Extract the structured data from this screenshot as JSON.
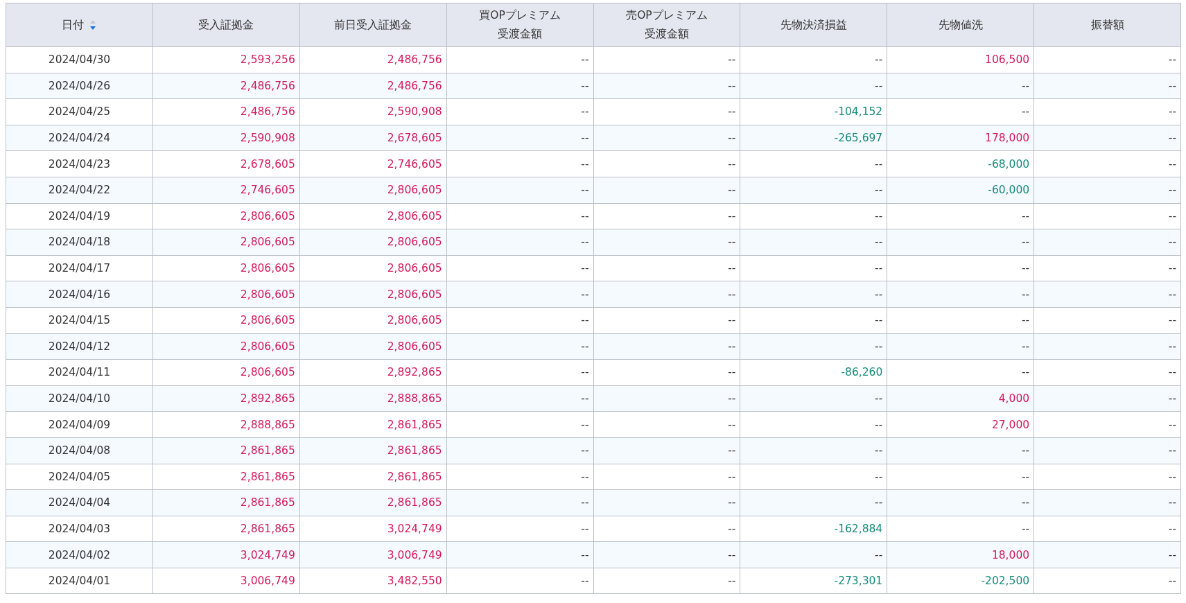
{
  "table": {
    "columns": [
      {
        "lines": [
          "日付"
        ],
        "sort_desc": true
      },
      {
        "lines": [
          "受入証拠金"
        ]
      },
      {
        "lines": [
          "前日受入証拠金"
        ]
      },
      {
        "lines": [
          "買OPプレミアム",
          "受渡金額"
        ]
      },
      {
        "lines": [
          "売OPプレミアム",
          "受渡金額"
        ]
      },
      {
        "lines": [
          "先物決済損益"
        ]
      },
      {
        "lines": [
          "先物値洗"
        ]
      },
      {
        "lines": [
          "振替額"
        ]
      }
    ],
    "rows": [
      {
        "cells": [
          {
            "v": "2024/04/30"
          },
          {
            "v": "2,593,256",
            "color": "#d2185a"
          },
          {
            "v": "2,486,756",
            "color": "#d2185a"
          },
          {
            "v": "--"
          },
          {
            "v": "--"
          },
          {
            "v": "--"
          },
          {
            "v": "106,500",
            "color": "#d2185a"
          },
          {
            "v": "--"
          }
        ]
      },
      {
        "cells": [
          {
            "v": "2024/04/26"
          },
          {
            "v": "2,486,756",
            "color": "#d2185a"
          },
          {
            "v": "2,486,756",
            "color": "#d2185a"
          },
          {
            "v": "--"
          },
          {
            "v": "--"
          },
          {
            "v": "--"
          },
          {
            "v": "--"
          },
          {
            "v": "--"
          }
        ]
      },
      {
        "cells": [
          {
            "v": "2024/04/25"
          },
          {
            "v": "2,486,756",
            "color": "#d2185a"
          },
          {
            "v": "2,590,908",
            "color": "#d2185a"
          },
          {
            "v": "--"
          },
          {
            "v": "--"
          },
          {
            "v": "-104,152",
            "color": "#178a7a"
          },
          {
            "v": "--"
          },
          {
            "v": "--"
          }
        ]
      },
      {
        "cells": [
          {
            "v": "2024/04/24"
          },
          {
            "v": "2,590,908",
            "color": "#d2185a"
          },
          {
            "v": "2,678,605",
            "color": "#d2185a"
          },
          {
            "v": "--"
          },
          {
            "v": "--"
          },
          {
            "v": "-265,697",
            "color": "#178a7a"
          },
          {
            "v": "178,000",
            "color": "#d2185a"
          },
          {
            "v": "--"
          }
        ]
      },
      {
        "cells": [
          {
            "v": "2024/04/23"
          },
          {
            "v": "2,678,605",
            "color": "#d2185a"
          },
          {
            "v": "2,746,605",
            "color": "#d2185a"
          },
          {
            "v": "--"
          },
          {
            "v": "--"
          },
          {
            "v": "--"
          },
          {
            "v": "-68,000",
            "color": "#178a7a"
          },
          {
            "v": "--"
          }
        ]
      },
      {
        "cells": [
          {
            "v": "2024/04/22"
          },
          {
            "v": "2,746,605",
            "color": "#d2185a"
          },
          {
            "v": "2,806,605",
            "color": "#d2185a"
          },
          {
            "v": "--"
          },
          {
            "v": "--"
          },
          {
            "v": "--"
          },
          {
            "v": "-60,000",
            "color": "#178a7a"
          },
          {
            "v": "--"
          }
        ]
      },
      {
        "cells": [
          {
            "v": "2024/04/19"
          },
          {
            "v": "2,806,605",
            "color": "#d2185a"
          },
          {
            "v": "2,806,605",
            "color": "#d2185a"
          },
          {
            "v": "--"
          },
          {
            "v": "--"
          },
          {
            "v": "--"
          },
          {
            "v": "--"
          },
          {
            "v": "--"
          }
        ]
      },
      {
        "cells": [
          {
            "v": "2024/04/18"
          },
          {
            "v": "2,806,605",
            "color": "#d2185a"
          },
          {
            "v": "2,806,605",
            "color": "#d2185a"
          },
          {
            "v": "--"
          },
          {
            "v": "--"
          },
          {
            "v": "--"
          },
          {
            "v": "--"
          },
          {
            "v": "--"
          }
        ]
      },
      {
        "cells": [
          {
            "v": "2024/04/17"
          },
          {
            "v": "2,806,605",
            "color": "#d2185a"
          },
          {
            "v": "2,806,605",
            "color": "#d2185a"
          },
          {
            "v": "--"
          },
          {
            "v": "--"
          },
          {
            "v": "--"
          },
          {
            "v": "--"
          },
          {
            "v": "--"
          }
        ]
      },
      {
        "cells": [
          {
            "v": "2024/04/16"
          },
          {
            "v": "2,806,605",
            "color": "#d2185a"
          },
          {
            "v": "2,806,605",
            "color": "#d2185a"
          },
          {
            "v": "--"
          },
          {
            "v": "--"
          },
          {
            "v": "--"
          },
          {
            "v": "--"
          },
          {
            "v": "--"
          }
        ]
      },
      {
        "cells": [
          {
            "v": "2024/04/15"
          },
          {
            "v": "2,806,605",
            "color": "#d2185a"
          },
          {
            "v": "2,806,605",
            "color": "#d2185a"
          },
          {
            "v": "--"
          },
          {
            "v": "--"
          },
          {
            "v": "--"
          },
          {
            "v": "--"
          },
          {
            "v": "--"
          }
        ]
      },
      {
        "cells": [
          {
            "v": "2024/04/12"
          },
          {
            "v": "2,806,605",
            "color": "#d2185a"
          },
          {
            "v": "2,806,605",
            "color": "#d2185a"
          },
          {
            "v": "--"
          },
          {
            "v": "--"
          },
          {
            "v": "--"
          },
          {
            "v": "--"
          },
          {
            "v": "--"
          }
        ]
      },
      {
        "cells": [
          {
            "v": "2024/04/11"
          },
          {
            "v": "2,806,605",
            "color": "#d2185a"
          },
          {
            "v": "2,892,865",
            "color": "#d2185a"
          },
          {
            "v": "--"
          },
          {
            "v": "--"
          },
          {
            "v": "-86,260",
            "color": "#178a7a"
          },
          {
            "v": "--"
          },
          {
            "v": "--"
          }
        ]
      },
      {
        "cells": [
          {
            "v": "2024/04/10"
          },
          {
            "v": "2,892,865",
            "color": "#d2185a"
          },
          {
            "v": "2,888,865",
            "color": "#d2185a"
          },
          {
            "v": "--"
          },
          {
            "v": "--"
          },
          {
            "v": "--"
          },
          {
            "v": "4,000",
            "color": "#d2185a"
          },
          {
            "v": "--"
          }
        ]
      },
      {
        "cells": [
          {
            "v": "2024/04/09"
          },
          {
            "v": "2,888,865",
            "color": "#d2185a"
          },
          {
            "v": "2,861,865",
            "color": "#d2185a"
          },
          {
            "v": "--"
          },
          {
            "v": "--"
          },
          {
            "v": "--"
          },
          {
            "v": "27,000",
            "color": "#d2185a"
          },
          {
            "v": "--"
          }
        ]
      },
      {
        "cells": [
          {
            "v": "2024/04/08"
          },
          {
            "v": "2,861,865",
            "color": "#d2185a"
          },
          {
            "v": "2,861,865",
            "color": "#d2185a"
          },
          {
            "v": "--"
          },
          {
            "v": "--"
          },
          {
            "v": "--"
          },
          {
            "v": "--"
          },
          {
            "v": "--"
          }
        ]
      },
      {
        "cells": [
          {
            "v": "2024/04/05"
          },
          {
            "v": "2,861,865",
            "color": "#d2185a"
          },
          {
            "v": "2,861,865",
            "color": "#d2185a"
          },
          {
            "v": "--"
          },
          {
            "v": "--"
          },
          {
            "v": "--"
          },
          {
            "v": "--"
          },
          {
            "v": "--"
          }
        ]
      },
      {
        "cells": [
          {
            "v": "2024/04/04"
          },
          {
            "v": "2,861,865",
            "color": "#d2185a"
          },
          {
            "v": "2,861,865",
            "color": "#d2185a"
          },
          {
            "v": "--"
          },
          {
            "v": "--"
          },
          {
            "v": "--"
          },
          {
            "v": "--"
          },
          {
            "v": "--"
          }
        ]
      },
      {
        "cells": [
          {
            "v": "2024/04/03"
          },
          {
            "v": "2,861,865",
            "color": "#d2185a"
          },
          {
            "v": "3,024,749",
            "color": "#d2185a"
          },
          {
            "v": "--"
          },
          {
            "v": "--"
          },
          {
            "v": "-162,884",
            "color": "#178a7a"
          },
          {
            "v": "--"
          },
          {
            "v": "--"
          }
        ]
      },
      {
        "cells": [
          {
            "v": "2024/04/02"
          },
          {
            "v": "3,024,749",
            "color": "#d2185a"
          },
          {
            "v": "3,006,749",
            "color": "#d2185a"
          },
          {
            "v": "--"
          },
          {
            "v": "--"
          },
          {
            "v": "--"
          },
          {
            "v": "18,000",
            "color": "#d2185a"
          },
          {
            "v": "--"
          }
        ]
      },
      {
        "cells": [
          {
            "v": "2024/04/01"
          },
          {
            "v": "3,006,749",
            "color": "#d2185a"
          },
          {
            "v": "3,482,550",
            "color": "#d2185a"
          },
          {
            "v": "--"
          },
          {
            "v": "--"
          },
          {
            "v": "-273,301",
            "color": "#178a7a"
          },
          {
            "v": "-202,500",
            "color": "#178a7a"
          },
          {
            "v": "--"
          }
        ]
      }
    ]
  }
}
